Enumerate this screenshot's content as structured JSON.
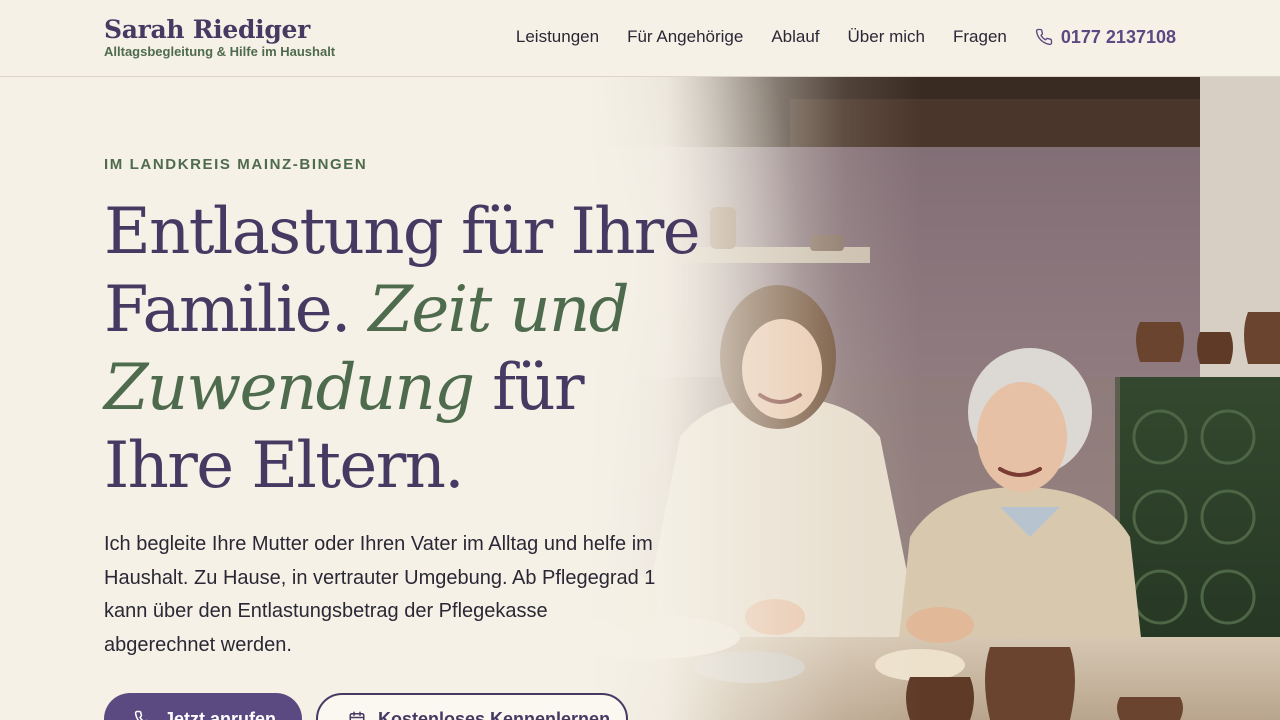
{
  "brand": {
    "name": "Sarah Riediger",
    "tagline": "Alltagsbegleitung & Hilfe im Haushalt"
  },
  "nav": {
    "items": [
      "Leistungen",
      "Für Angehörige",
      "Ablauf",
      "Über mich",
      "Fragen"
    ],
    "phone": "0177 2137108",
    "phone_icon": "phone-icon"
  },
  "hero": {
    "eyebrow": "IM LANDKREIS MAINZ-BINGEN",
    "headline": {
      "part1": "Entlastung für Ihre Familie.",
      "accent": "Zeit und Zuwendung",
      "part2": "für Ihre Eltern."
    },
    "lead": "Ich begleite Ihre Mutter oder Ihren Vater im Alltag und helfe im Haushalt. Zu Hause, in vertrauter Umgebung. Ab Pflegegrad 1 kann über den Entlastungsbetrag der Pflegekasse abgerechnet werden.",
    "cta_primary": "Jetzt anrufen",
    "cta_secondary": "Kostenloses Kennenlernen",
    "photo": "photo-two-women-baking-kitchen"
  },
  "colors": {
    "background": "#f5f1e7",
    "primary": "#5b4a82",
    "headline": "#463a63",
    "accent_green": "#4f6b4d"
  }
}
